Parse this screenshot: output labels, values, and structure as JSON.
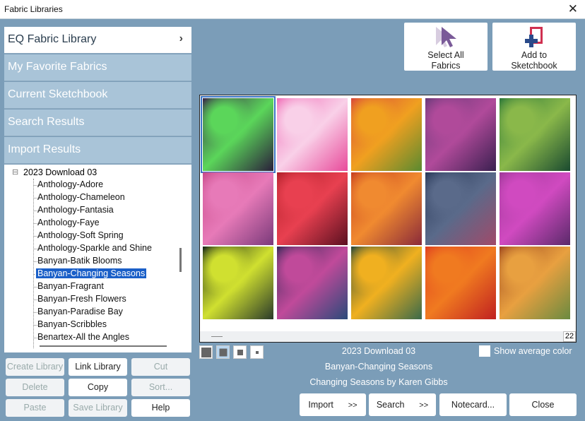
{
  "window": {
    "title": "Fabric Libraries",
    "close": "✕"
  },
  "categories": [
    {
      "label": "EQ Fabric Library",
      "chevron": "›"
    },
    {
      "label": "My Favorite Fabrics"
    },
    {
      "label": "Current Sketchbook"
    },
    {
      "label": "Search Results"
    },
    {
      "label": "Import Results"
    }
  ],
  "tree": {
    "parent": "2023 Download 03",
    "expander": "⊟",
    "items": [
      "Anthology-Adore",
      "Anthology-Chameleon",
      "Anthology-Fantasia",
      "Anthology-Faye",
      "Anthology-Soft Spring",
      "Anthology-Sparkle and Shine",
      "Banyan-Batik Blooms",
      "Banyan-Changing Seasons",
      "Banyan-Fragrant",
      "Banyan-Fresh Flowers",
      "Banyan-Paradise Bay",
      "Banyan-Scribbles",
      "Benartex-All the Angles"
    ],
    "selected_index": 7
  },
  "library_buttons": [
    {
      "label": "Create Library",
      "enabled": false
    },
    {
      "label": "Link Library",
      "enabled": true
    },
    {
      "label": "Cut",
      "enabled": false
    },
    {
      "label": "Delete",
      "enabled": false
    },
    {
      "label": "Copy",
      "enabled": true
    },
    {
      "label": "Sort...",
      "enabled": false
    },
    {
      "label": "Paste",
      "enabled": false
    },
    {
      "label": "Save Library",
      "enabled": false
    },
    {
      "label": "Help",
      "enabled": true
    }
  ],
  "toolbar": {
    "select_all": "Select All Fabrics",
    "add_sketchbook": "Add to Sketchbook"
  },
  "grid": {
    "count": "22",
    "selected_index": 0,
    "swatches": [
      [
        "#3a2a4a",
        "#5bd65a",
        "#2a1e3a"
      ],
      [
        "#f06fb8",
        "#f9d0e8",
        "#e84a9a"
      ],
      [
        "#d94a3a",
        "#f0a020",
        "#5a8a30"
      ],
      [
        "#6a3a7a",
        "#b04a9a",
        "#3a2050"
      ],
      [
        "#2f7a3a",
        "#8ab84a",
        "#1a4a30"
      ],
      [
        "#c84a8a",
        "#e77ab8",
        "#7a3a7a"
      ],
      [
        "#b0202a",
        "#e84050",
        "#5a1020"
      ],
      [
        "#c84020",
        "#f08a30",
        "#8a2a3a"
      ],
      [
        "#2a3a5a",
        "#5a6a8a",
        "#a04a6a"
      ],
      [
        "#a03a9a",
        "#d04ac0",
        "#5a2a6a"
      ],
      [
        "#1a2a1a",
        "#d0e030",
        "#2a3a2a"
      ],
      [
        "#3a2a5a",
        "#c04a9a",
        "#2a4a7a"
      ],
      [
        "#2a4a3a",
        "#f0b020",
        "#3a6a4a"
      ],
      [
        "#e04020",
        "#f07a20",
        "#c02020"
      ],
      [
        "#a04a20",
        "#e8a040",
        "#6a8a40"
      ]
    ]
  },
  "info": {
    "library": "2023 Download 03",
    "collection": "Banyan-Changing Seasons",
    "description": "Changing Seasons by Karen Gibbs",
    "show_average": "Show average color"
  },
  "actions": {
    "import": "Import",
    "search": "Search",
    "more": ">>",
    "notecard": "Notecard...",
    "close": "Close"
  }
}
